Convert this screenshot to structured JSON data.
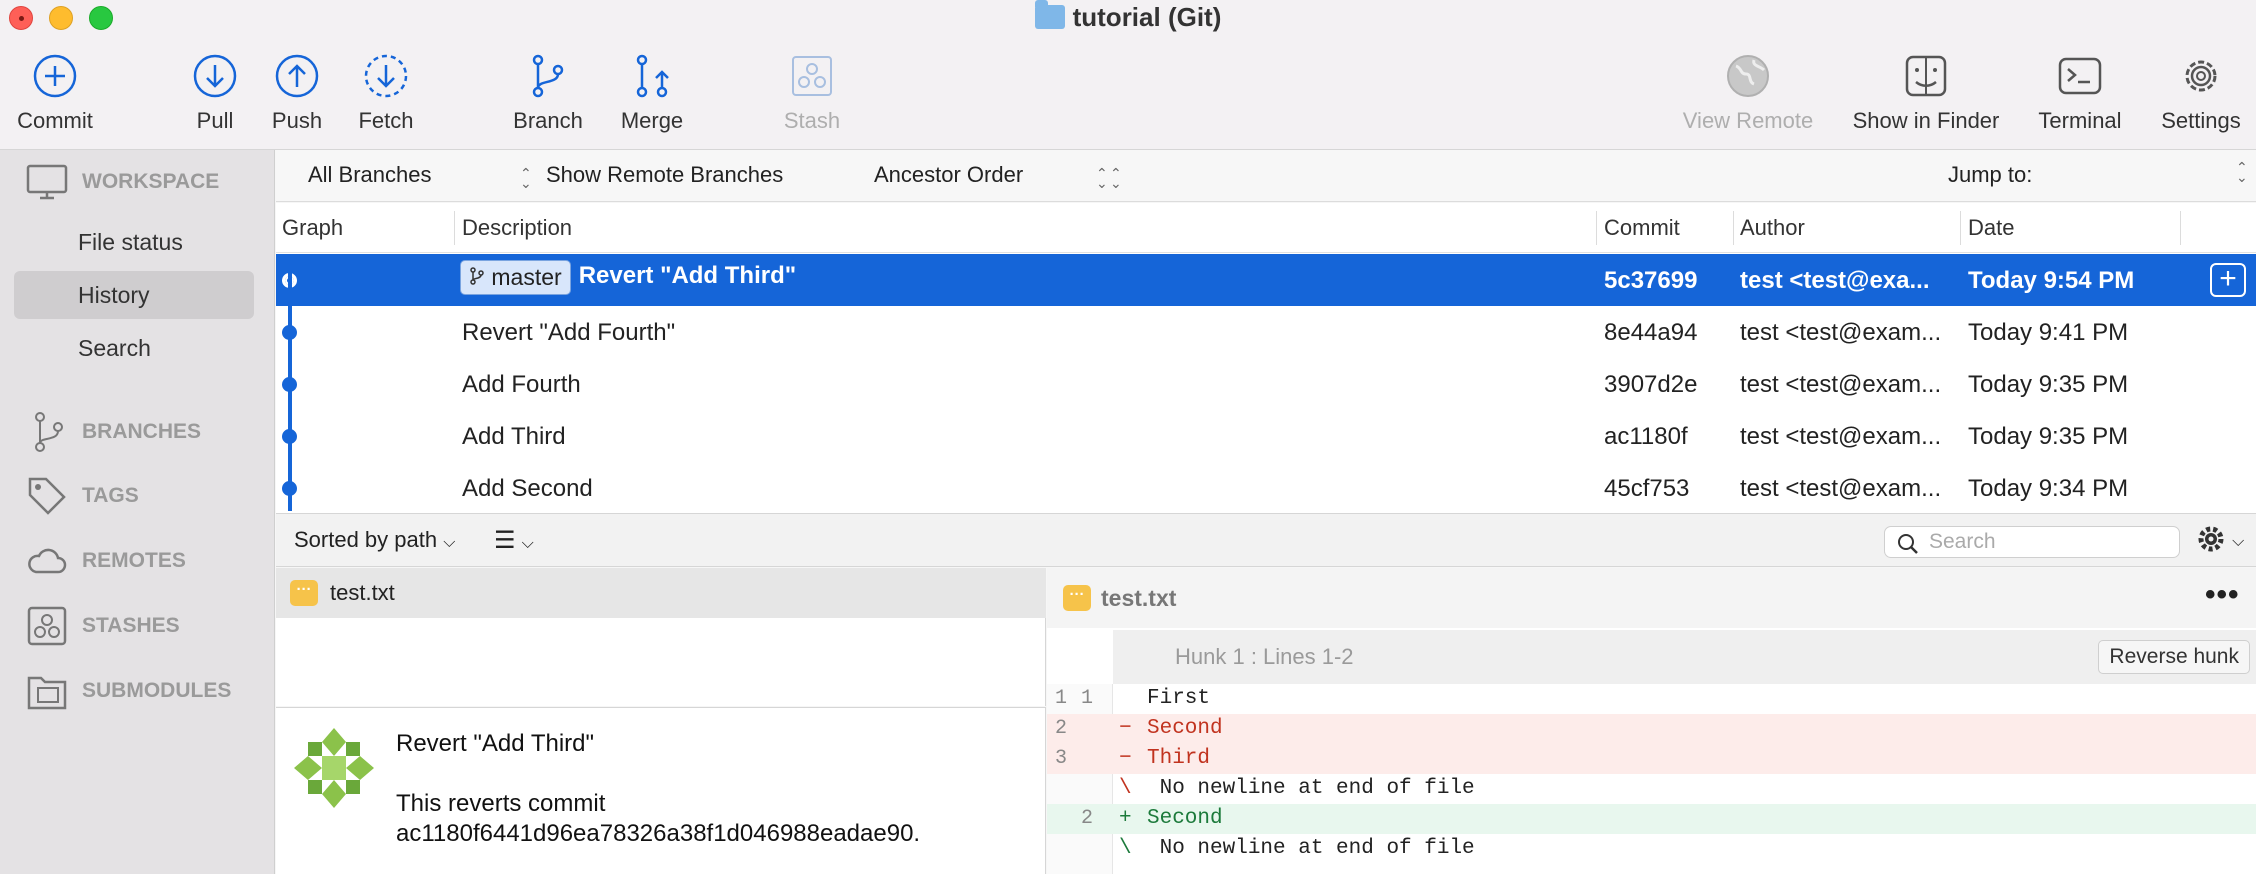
{
  "window": {
    "title": "tutorial (Git)"
  },
  "toolbar": {
    "commit": "Commit",
    "pull": "Pull",
    "push": "Push",
    "fetch": "Fetch",
    "branch": "Branch",
    "merge": "Merge",
    "stash": "Stash",
    "view_remote": "View Remote",
    "show_in_finder": "Show in Finder",
    "terminal": "Terminal",
    "settings": "Settings"
  },
  "sidebar": {
    "workspace": "WORKSPACE",
    "file_status": "File status",
    "history": "History",
    "search": "Search",
    "branches": "BRANCHES",
    "tags": "TAGS",
    "remotes": "REMOTES",
    "stashes": "STASHES",
    "submodules": "SUBMODULES"
  },
  "filters": {
    "branches": "All Branches",
    "remote": "Show Remote Branches",
    "order": "Ancestor Order",
    "jump_to": "Jump to:"
  },
  "history": {
    "columns": {
      "graph": "Graph",
      "description": "Description",
      "commit": "Commit",
      "author": "Author",
      "date": "Date"
    },
    "rows": [
      {
        "branch": "master",
        "description": "Revert \"Add Third\"",
        "commit": "5c37699",
        "author": "test <test@exa...",
        "date": "Today 9:54 PM"
      },
      {
        "description": "Revert \"Add Fourth\"",
        "commit": "8e44a94",
        "author": "test <test@exam...",
        "date": "Today 9:41 PM"
      },
      {
        "description": "Add Fourth",
        "commit": "3907d2e",
        "author": "test <test@exam...",
        "date": "Today 9:35 PM"
      },
      {
        "description": "Add Third",
        "commit": "ac1180f",
        "author": "test <test@exam...",
        "date": "Today 9:35 PM"
      },
      {
        "description": "Add Second",
        "commit": "45cf753",
        "author": "test <test@exam...",
        "date": "Today 9:34 PM"
      }
    ]
  },
  "files_toolbar": {
    "sort": "Sorted by path",
    "search_placeholder": "Search"
  },
  "files": [
    {
      "name": "test.txt"
    }
  ],
  "commit_detail": {
    "title": "Revert \"Add Third\"",
    "body_line1": "This reverts commit",
    "body_line2": "ac1180f6441d96ea78326a38f1d046988eadae90."
  },
  "diff": {
    "file": "test.txt",
    "hunk": "Hunk 1 : Lines 1-2",
    "reverse_hunk": "Reverse hunk",
    "lines": [
      {
        "old": "1",
        "new": "1",
        "sym": "",
        "text": "First"
      },
      {
        "old": "2",
        "new": "",
        "sym": "−",
        "text": "Second"
      },
      {
        "old": "3",
        "new": "",
        "sym": "−",
        "text": "Third"
      },
      {
        "old": "",
        "new": "",
        "sym": "\\",
        "text": " No newline at end of file"
      },
      {
        "old": "",
        "new": "2",
        "sym": "+",
        "text": "Second"
      },
      {
        "old": "",
        "new": "",
        "sym": "\\",
        "text": " No newline at end of file"
      }
    ]
  },
  "colors": {
    "accent": "#1565d8",
    "deleted_bg": "#fdecea",
    "added_bg": "#e8f7ee",
    "file_badge": "#f6c34a"
  }
}
